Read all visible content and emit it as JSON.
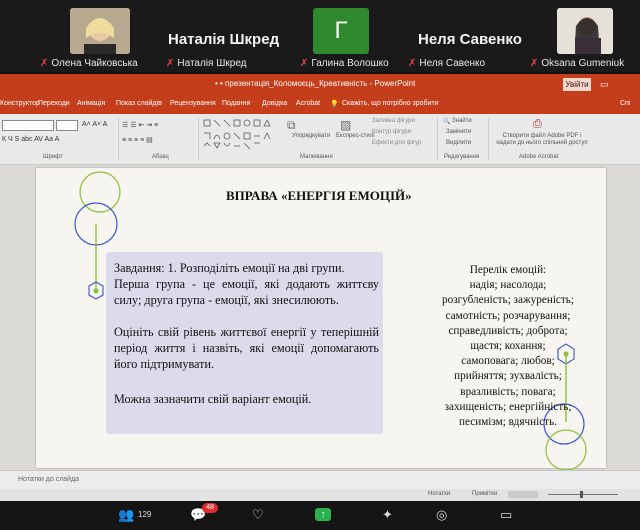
{
  "participants": [
    {
      "name": "Олена Чайковська"
    },
    {
      "name": "Наталія Шкред"
    },
    {
      "name": "Галина Волошко"
    },
    {
      "name": "Неля Савенко"
    },
    {
      "name": "Oksana Gumeniuk"
    }
  ],
  "big_names": [
    "Наталія Шкред",
    "Неля Савенко"
  ],
  "avatar_letter": "Г",
  "ppt": {
    "title": "• • презентація_Коломоєць_Креативність  -  PowerPoint",
    "signin": "Увійти",
    "share": "Спі",
    "tabs": [
      "Конструктор",
      "Переходи",
      "Анімація",
      "Показ слайдів",
      "Рецензування",
      "Подання",
      "Довідка",
      "Acrobat",
      "Скажіть, що потрібно зробити"
    ],
    "groups": {
      "font": "Шрифт",
      "paragraph": "Абзац",
      "drawing": "Малювання",
      "editing": "Редагування",
      "acrobat": "Adobe Acrobat"
    },
    "ribbon_texts": {
      "arrange": "Упорядкувати",
      "quick_styles": "Експрес-стилі",
      "fill": "Заливка фігури",
      "outline": "Контур фігури",
      "effects": "Ефекти для фігур",
      "find": "Знайти",
      "replace": "Замінити",
      "select": "Виділити",
      "acrobat_btn": "Створити файл Adobe PDF і надати до нього спільний доступ"
    },
    "notes_placeholder": "Нотатки до слайда",
    "status": {
      "notes": "Нотатки",
      "comments": "Примітки"
    }
  },
  "slide": {
    "title": "ВПРАВА «ЕНЕРГІЯ ЕМОЦІЙ»",
    "task": {
      "line1": "Завдання: 1. Розподіліть емоції на дві групи.",
      "line2": "Перша група  - це емоції, які додають життєву силу; друга група - емоції, які знесилюють.",
      "line3": "Оцініть свій рівень життєвої енергії у теперішній період життя і назвіть, які емоції допомагають його підтримувати.",
      "line4": "Можна зазначити свій варіант емоцій."
    },
    "emotions": [
      "Перелік емоцій:",
      "надія; насолода;",
      "розгубленість; зажуреність;",
      "самотність; розчарування;",
      "справедливість; доброта;",
      "щастя; кохання;",
      "самоповага; любов;",
      "прийняття; зухвалість;",
      "вразливість; повага;",
      "захищеність; енергійність;",
      "песимізм; вдячність."
    ]
  },
  "zoom_controls": {
    "participants_count": "129",
    "chat_badge": "48"
  }
}
